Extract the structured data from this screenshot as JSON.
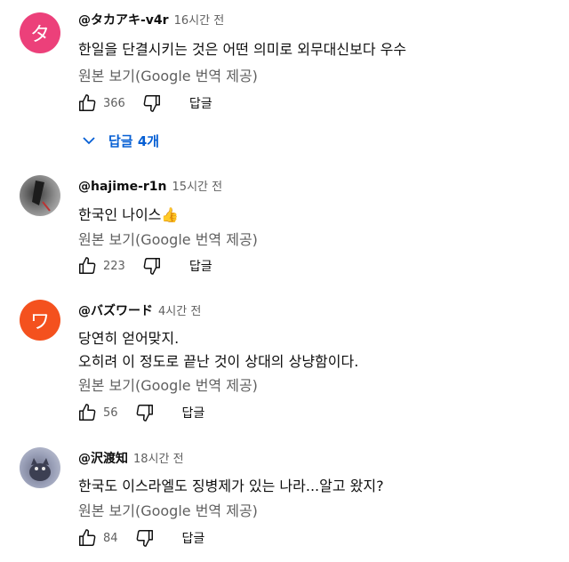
{
  "comments": [
    {
      "avatar_letter": "タ",
      "handle": "@タカアキ-v4r",
      "time": "16시간 전",
      "lines": [
        "한일을 단결시키는 것은 어떤 의미로 외무대신보다 우수"
      ],
      "translate_label": "원본 보기(Google 번역 제공)",
      "likes": "366",
      "reply_label": "답글",
      "replies_toggle": "답글 4개"
    },
    {
      "avatar_letter": "",
      "handle": "@hajime-r1n",
      "time": "15시간 전",
      "lines": [
        "한국인 나이스👍"
      ],
      "translate_label": "원본 보기(Google 번역 제공)",
      "likes": "223",
      "reply_label": "답글"
    },
    {
      "avatar_letter": "ワ",
      "handle": "@バズワード",
      "time": "4시간 전",
      "lines": [
        "당연히 얻어맞지.",
        "오히려 이 정도로 끝난 것이 상대의 상냥함이다."
      ],
      "translate_label": "원본 보기(Google 번역 제공)",
      "likes": "56",
      "reply_label": "답글"
    },
    {
      "avatar_letter": "",
      "handle": "@沢渡知",
      "time": "18시간 전",
      "lines": [
        "한국도 이스라엘도 징병제가 있는 나라...알고 왔지?"
      ],
      "translate_label": "원본 보기(Google 번역 제공)",
      "likes": "84",
      "reply_label": "답글"
    }
  ],
  "colors": {
    "accent_blue": "#065fd4",
    "avatar_pink": "#ec407a",
    "avatar_orange": "#f4511e",
    "secondary_text": "#606060"
  },
  "icons": {
    "like": "thumbs-up-outline-icon",
    "dislike": "thumbs-down-outline-icon",
    "expand": "chevron-down-icon"
  }
}
